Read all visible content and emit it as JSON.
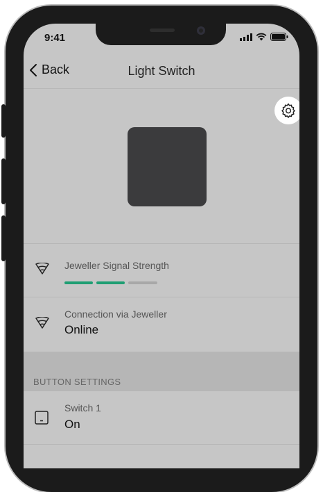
{
  "status_bar": {
    "time": "9:41"
  },
  "nav": {
    "back_label": "Back",
    "title": "Light Switch"
  },
  "signal": {
    "label": "Jeweller Signal Strength",
    "level": 2,
    "max": 3
  },
  "connection": {
    "label": "Connection via Jeweller",
    "value": "Online"
  },
  "section": {
    "title": "BUTTON SETTINGS"
  },
  "switch1": {
    "label": "Switch 1",
    "value": "On"
  },
  "colors": {
    "screen_bg": "#c6c6c6",
    "signal_active": "#1f9e73",
    "signal_inactive": "#a8a8a8",
    "device": "#3b3b3d"
  }
}
